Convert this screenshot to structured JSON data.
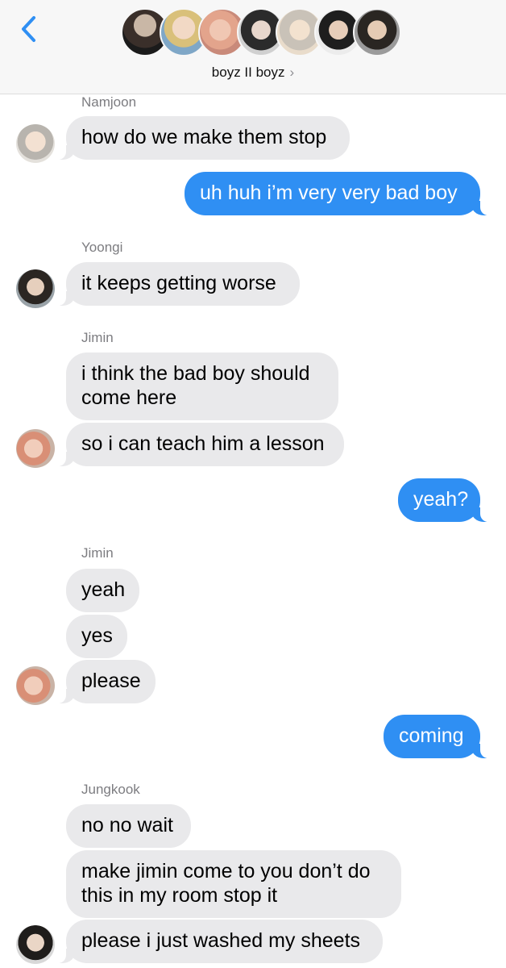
{
  "header": {
    "title": "boyz II boyz",
    "chevron": "›",
    "back_icon": "chevron-left-icon",
    "accent": "#2f8ff3",
    "member_count": 7
  },
  "messages": [
    {
      "sender": "Namjoon",
      "text": "how do we make them stop"
    },
    {
      "from_me": true,
      "text": "uh huh i’m very very bad boy"
    },
    {
      "sender": "Yoongi",
      "text": "it keeps getting worse"
    },
    {
      "sender": "Jimin",
      "text": "i think the bad boy should come here"
    },
    {
      "text": "so i can teach him a lesson"
    },
    {
      "from_me": true,
      "text": "yeah?"
    },
    {
      "sender": "Jimin",
      "text": "yeah"
    },
    {
      "text": "yes"
    },
    {
      "text": "please"
    },
    {
      "from_me": true,
      "text": "coming"
    },
    {
      "sender": "Jungkook",
      "text": "no no wait"
    },
    {
      "text": "make jimin come to you don’t do this in my room stop it"
    },
    {
      "text": "please i just washed my sheets"
    }
  ],
  "colors": {
    "incoming": "#e9e9eb",
    "outgoing": "#2f8ff3",
    "sender_label": "#7c7c80"
  }
}
